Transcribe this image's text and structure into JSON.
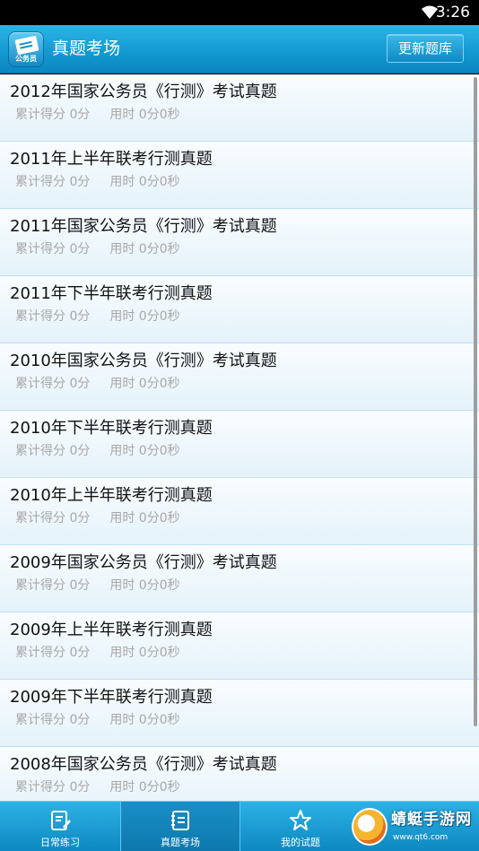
{
  "status_bar": {
    "time": "3:26"
  },
  "header": {
    "logo_text": "公务员",
    "title": "真题考场",
    "update_button": "更新题库"
  },
  "list": {
    "items": [
      {
        "title": "2012年国家公务员《行测》考试真题",
        "score": "累计得分 0分",
        "time": "用时 0分0秒"
      },
      {
        "title": "2011年上半年联考行测真题",
        "score": "累计得分 0分",
        "time": "用时 0分0秒"
      },
      {
        "title": "2011年国家公务员《行测》考试真题",
        "score": "累计得分 0分",
        "time": "用时 0分0秒"
      },
      {
        "title": "2011年下半年联考行测真题",
        "score": "累计得分 0分",
        "time": "用时 0分0秒"
      },
      {
        "title": "2010年国家公务员《行测》考试真题",
        "score": "累计得分 0分",
        "time": "用时 0分0秒"
      },
      {
        "title": "2010年下半年联考行测真题",
        "score": "累计得分 0分",
        "time": "用时 0分0秒"
      },
      {
        "title": "2010年上半年联考行测真题",
        "score": "累计得分 0分",
        "time": "用时 0分0秒"
      },
      {
        "title": "2009年国家公务员《行测》考试真题",
        "score": "累计得分 0分",
        "time": "用时 0分0秒"
      },
      {
        "title": "2009年上半年联考行测真题",
        "score": "累计得分 0分",
        "time": "用时 0分0秒"
      },
      {
        "title": "2009年下半年联考行测真题",
        "score": "累计得分 0分",
        "time": "用时 0分0秒"
      },
      {
        "title": "2008年国家公务员《行测》考试真题",
        "score": "累计得分 0分",
        "time": "用时 0分0秒"
      }
    ]
  },
  "tabs": [
    {
      "label": "日常练习",
      "icon": "edit-note-icon",
      "active": false
    },
    {
      "label": "真题考场",
      "icon": "notebook-icon",
      "active": true
    },
    {
      "label": "我的试题",
      "icon": "star-icon",
      "active": false
    }
  ],
  "watermark": {
    "title": "蜻蜓手游网",
    "url": "www.qt6.com"
  },
  "colors": {
    "header": "#149ad2",
    "tab_bar": "#0e88c2",
    "divider": "#bfe0f0",
    "meta_text": "#a8a8a8"
  }
}
